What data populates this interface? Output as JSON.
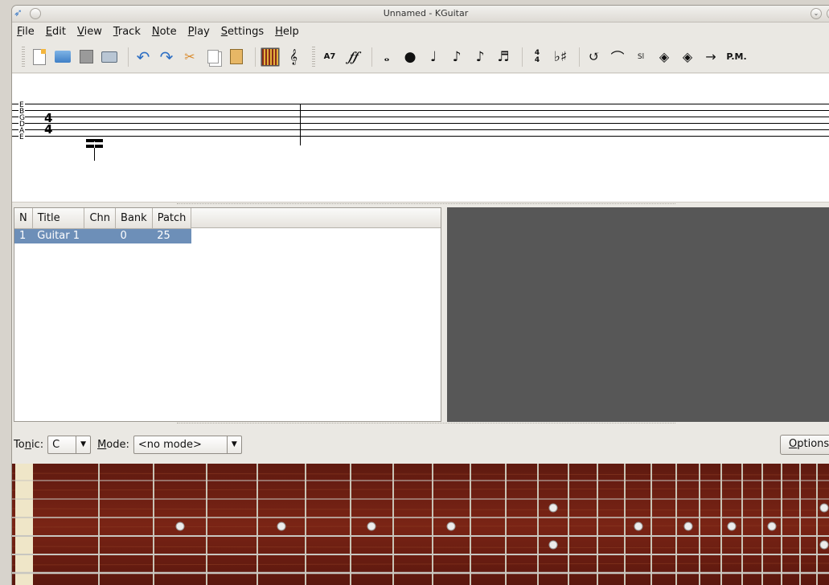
{
  "window": {
    "title": "Unnamed - KGuitar"
  },
  "menu": [
    {
      "key": "F",
      "rest": "ile"
    },
    {
      "key": "E",
      "rest": "dit"
    },
    {
      "key": "V",
      "rest": "iew"
    },
    {
      "key": "T",
      "rest": "rack"
    },
    {
      "key": "N",
      "rest": "ote"
    },
    {
      "key": "P",
      "rest": "lay"
    },
    {
      "key": "S",
      "rest": "ettings"
    },
    {
      "key": "H",
      "rest": "elp"
    }
  ],
  "toolbar": {
    "chord_label": "A7",
    "time_sig_top": "4",
    "time_sig_bottom": "4",
    "key_sig": "♭♯",
    "slide_label": "Sl",
    "palm_mute": "P.M."
  },
  "tab": {
    "strings": [
      "E",
      "B",
      "G",
      "D",
      "A",
      "E"
    ],
    "time_sig_top": "4",
    "time_sig_bottom": "4"
  },
  "tracks": {
    "headers": [
      "N",
      "Title",
      "Chn",
      "Bank",
      "Patch"
    ],
    "rows": [
      {
        "n": "1",
        "title": "Guitar 1",
        "chn": "",
        "bank": "0",
        "patch": "25"
      }
    ]
  },
  "bottom": {
    "tonic_label_pre": "To",
    "tonic_label_key": "n",
    "tonic_label_post": "ic:",
    "tonic_value": "C",
    "mode_key": "M",
    "mode_rest": "ode:",
    "mode_value": "<no mode>",
    "options_key": "O",
    "options_rest": "ptions..."
  },
  "colors": {
    "fretboard_wood": "#6e1e12",
    "selection": "#6d8fb8",
    "dark_pane": "#575757"
  }
}
